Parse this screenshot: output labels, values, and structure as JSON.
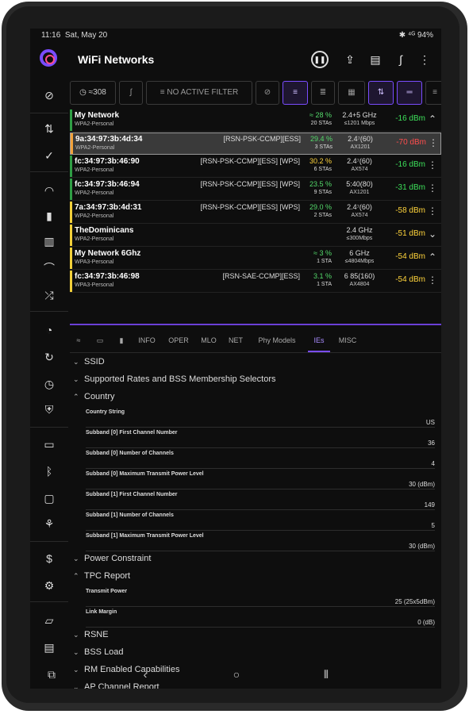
{
  "status": {
    "time": "11:16",
    "date": "Sat, May 20",
    "battery": "94%"
  },
  "app": {
    "title": "WiFi Networks"
  },
  "toolbar": {
    "counter": "≈308",
    "filter": "NO ACTIVE FILTER"
  },
  "networks": [
    {
      "name": "My Network",
      "sec": "WPA2-Personal",
      "cap": "",
      "pct": "≈ 28 %",
      "sta": "20 STAs",
      "ch": "2.4+5 GHz",
      "chs": "≤1201 Mbps",
      "sig": "-16 dBm",
      "chev": "⌃",
      "bar": "#2f9e44",
      "pctcolor": "#53d96a",
      "sigcolor": "#3de05a"
    },
    {
      "name": "9a:34:97:3b:4d:34",
      "sec": "WPA2-Personal",
      "cap": "[RSN-PSK-CCMP][ESS]",
      "pct": "29.4 %",
      "sta": "3 STAs",
      "ch": "2.4⁷(60)",
      "chs": "AX1201",
      "sig": "-70 dBm",
      "chev": "⋮",
      "bar": "#f2a23a",
      "pctcolor": "#53d96a",
      "sigcolor": "#ff4d4d"
    },
    {
      "name": "fc:34:97:3b:46:90",
      "sec": "WPA2-Personal",
      "cap": "[RSN-PSK-CCMP][ESS] [WPS]",
      "pct": "30.2 %",
      "sta": "6 STAs",
      "ch": "2.4⁷(60)",
      "chs": "AX574",
      "sig": "-16 dBm",
      "chev": "⋮",
      "bar": "#2f9e44",
      "pctcolor": "#ffd43b",
      "sigcolor": "#3de05a"
    },
    {
      "name": "fc:34:97:3b:46:94",
      "sec": "WPA2-Personal",
      "cap": "[RSN-PSK-CCMP][ESS] [WPS]",
      "pct": "23.5 %",
      "sta": "9 STAs",
      "ch": "5:40(80)",
      "chs": "AX1201",
      "sig": "-31 dBm",
      "chev": "⋮",
      "bar": "#2f9e44",
      "pctcolor": "#53d96a",
      "sigcolor": "#3de05a"
    },
    {
      "name": "7a:34:97:3b:4d:31",
      "sec": "WPA2-Personal",
      "cap": "[RSN-PSK-CCMP][ESS] [WPS]",
      "pct": "29.0 %",
      "sta": "2 STAs",
      "ch": "2.4⁷(60)",
      "chs": "AX574",
      "sig": "-58 dBm",
      "chev": "⋮",
      "bar": "#f2d03a",
      "pctcolor": "#53d96a",
      "sigcolor": "#ffd43b"
    },
    {
      "name": "TheDominicans",
      "sec": "WPA2-Personal",
      "cap": "",
      "pct": "",
      "sta": "",
      "ch": "2.4 GHz",
      "chs": "≤300Mbps",
      "sig": "-51 dBm",
      "chev": "⌄",
      "bar": "#f2d03a",
      "pctcolor": "#53d96a",
      "sigcolor": "#ffd43b"
    },
    {
      "name": "My Network 6Ghz",
      "sec": "WPA3-Personal",
      "cap": "",
      "pct": "≈ 3 %",
      "sta": "1 STA",
      "ch": "6 GHz",
      "chs": "≤4804Mbps",
      "sig": "-54 dBm",
      "chev": "⌃",
      "bar": "#f2d03a",
      "pctcolor": "#53d96a",
      "sigcolor": "#ffd43b"
    },
    {
      "name": "fc:34:97:3b:46:98",
      "sec": "WPA3-Personal",
      "cap": "[RSN-SAE-CCMP][ESS]",
      "pct": "3.1 %",
      "sta": "1 STA",
      "ch": "6 85(160)",
      "chs": "AX4804",
      "sig": "-54 dBm",
      "chev": "⋮",
      "bar": "#f2d03a",
      "pctcolor": "#53d96a",
      "sigcolor": "#ffd43b"
    }
  ],
  "tabs": [
    "INFO",
    "OPER",
    "MLO",
    "NET",
    "Phy Models",
    "IEs",
    "MISC"
  ],
  "ies": {
    "ssid": "SSID",
    "rates": "Supported Rates and BSS Membership Selectors",
    "country": "Country",
    "country_fields": [
      {
        "k": "Country String",
        "v": "US"
      },
      {
        "k": "Subband [0] First Channel Number",
        "v": "36"
      },
      {
        "k": "Subband [0] Number of Channels",
        "v": "4"
      },
      {
        "k": "Subband [0] Maximum Transmit Power Level",
        "v": "30 (dBm)"
      },
      {
        "k": "Subband [1] First Channel Number",
        "v": "149"
      },
      {
        "k": "Subband [1] Number of Channels",
        "v": "5"
      },
      {
        "k": "Subband [1] Maximum Transmit Power Level",
        "v": "30 (dBm)"
      }
    ],
    "power": "Power Constraint",
    "tpc": "TPC Report",
    "tpc_fields": [
      {
        "k": "Transmit Power",
        "v": "25 (25x5dBm)"
      },
      {
        "k": "Link Margin",
        "v": "0 (dB)"
      }
    ],
    "rsne": "RSNE",
    "bss": "BSS Load",
    "rm": "RM Enabled Capabilities",
    "ap": "AP Channel Report"
  }
}
